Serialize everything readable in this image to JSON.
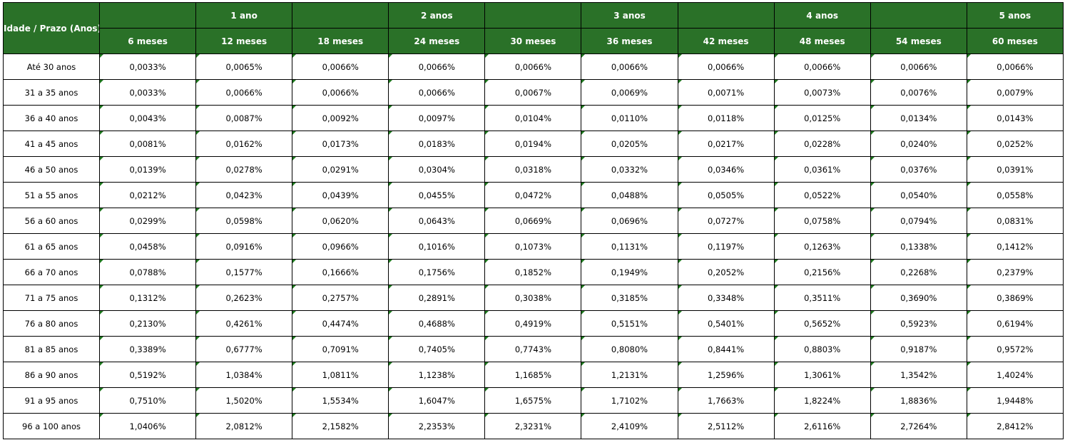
{
  "header": {
    "corner_label": "Idade / Prazo (Anos)",
    "year_labels": [
      "",
      "1 ano",
      "",
      "2 anos",
      "",
      "3 anos",
      "",
      "4 anos",
      "",
      "5 anos"
    ],
    "month_labels": [
      "6 meses",
      "12 meses",
      "18 meses",
      "24 meses",
      "30 meses",
      "36 meses",
      "42 meses",
      "48 meses",
      "54 meses",
      "60 meses"
    ]
  },
  "colors": {
    "header_bg": "#2a7128",
    "header_text": "#ffffff",
    "cell_marker": "#1f7a1f"
  },
  "rows": [
    {
      "age": "Até 30 anos",
      "values": [
        "0,0033%",
        "0,0065%",
        "0,0066%",
        "0,0066%",
        "0,0066%",
        "0,0066%",
        "0,0066%",
        "0,0066%",
        "0,0066%",
        "0,0066%"
      ]
    },
    {
      "age": "31 a 35 anos",
      "values": [
        "0,0033%",
        "0,0066%",
        "0,0066%",
        "0,0066%",
        "0,0067%",
        "0,0069%",
        "0,0071%",
        "0,0073%",
        "0,0076%",
        "0,0079%"
      ]
    },
    {
      "age": "36 a 40 anos",
      "values": [
        "0,0043%",
        "0,0087%",
        "0,0092%",
        "0,0097%",
        "0,0104%",
        "0,0110%",
        "0,0118%",
        "0,0125%",
        "0,0134%",
        "0,0143%"
      ]
    },
    {
      "age": "41 a 45 anos",
      "values": [
        "0,0081%",
        "0,0162%",
        "0,0173%",
        "0,0183%",
        "0,0194%",
        "0,0205%",
        "0,0217%",
        "0,0228%",
        "0,0240%",
        "0,0252%"
      ]
    },
    {
      "age": "46 a 50 anos",
      "values": [
        "0,0139%",
        "0,0278%",
        "0,0291%",
        "0,0304%",
        "0,0318%",
        "0,0332%",
        "0,0346%",
        "0,0361%",
        "0,0376%",
        "0,0391%"
      ]
    },
    {
      "age": "51 a 55 anos",
      "values": [
        "0,0212%",
        "0,0423%",
        "0,0439%",
        "0,0455%",
        "0,0472%",
        "0,0488%",
        "0,0505%",
        "0,0522%",
        "0,0540%",
        "0,0558%"
      ]
    },
    {
      "age": "56 a 60 anos",
      "values": [
        "0,0299%",
        "0,0598%",
        "0,0620%",
        "0,0643%",
        "0,0669%",
        "0,0696%",
        "0,0727%",
        "0,0758%",
        "0,0794%",
        "0,0831%"
      ]
    },
    {
      "age": "61 a 65 anos",
      "values": [
        "0,0458%",
        "0,0916%",
        "0,0966%",
        "0,1016%",
        "0,1073%",
        "0,1131%",
        "0,1197%",
        "0,1263%",
        "0,1338%",
        "0,1412%"
      ]
    },
    {
      "age": "66 a 70 anos",
      "values": [
        "0,0788%",
        "0,1577%",
        "0,1666%",
        "0,1756%",
        "0,1852%",
        "0,1949%",
        "0,2052%",
        "0,2156%",
        "0,2268%",
        "0,2379%"
      ]
    },
    {
      "age": "71 a 75 anos",
      "values": [
        "0,1312%",
        "0,2623%",
        "0,2757%",
        "0,2891%",
        "0,3038%",
        "0,3185%",
        "0,3348%",
        "0,3511%",
        "0,3690%",
        "0,3869%"
      ]
    },
    {
      "age": "76 a 80 anos",
      "values": [
        "0,2130%",
        "0,4261%",
        "0,4474%",
        "0,4688%",
        "0,4919%",
        "0,5151%",
        "0,5401%",
        "0,5652%",
        "0,5923%",
        "0,6194%"
      ]
    },
    {
      "age": "81 a 85 anos",
      "values": [
        "0,3389%",
        "0,6777%",
        "0,7091%",
        "0,7405%",
        "0,7743%",
        "0,8080%",
        "0,8441%",
        "0,8803%",
        "0,9187%",
        "0,9572%"
      ]
    },
    {
      "age": "86 a 90 anos",
      "values": [
        "0,5192%",
        "1,0384%",
        "1,0811%",
        "1,1238%",
        "1,1685%",
        "1,2131%",
        "1,2596%",
        "1,3061%",
        "1,3542%",
        "1,4024%"
      ]
    },
    {
      "age": "91 a 95 anos",
      "values": [
        "0,7510%",
        "1,5020%",
        "1,5534%",
        "1,6047%",
        "1,6575%",
        "1,7102%",
        "1,7663%",
        "1,8224%",
        "1,8836%",
        "1,9448%"
      ]
    },
    {
      "age": "96 a 100 anos",
      "values": [
        "1,0406%",
        "2,0812%",
        "2,1582%",
        "2,2353%",
        "2,3231%",
        "2,4109%",
        "2,5112%",
        "2,6116%",
        "2,7264%",
        "2,8412%"
      ]
    }
  ]
}
